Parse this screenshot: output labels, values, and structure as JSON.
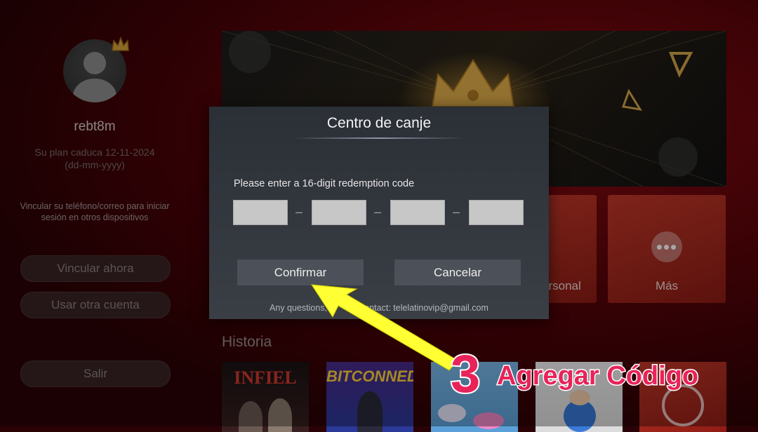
{
  "profile": {
    "username": "rebt8m",
    "plan_expiry": "Su plan caduca 12-11-2024",
    "date_format": "(dd-mm-yyyy)",
    "link_message_line1": "Vincular su teléfono/correo para iniciar",
    "link_message_line2": "sesión en otros dispositivos",
    "buttons": {
      "link_now": "Vincular ahora",
      "use_other_account": "Usar otra cuenta",
      "exit": "Salir"
    }
  },
  "tiles": [
    {
      "label": "ersonal"
    },
    {
      "label": "Más",
      "icon": "more-dots-icon"
    }
  ],
  "history": {
    "title": "Historia",
    "thumbnails": [
      {
        "title": "INFIEL"
      },
      {
        "title": "BITCONNED"
      },
      {
        "title": ""
      },
      {
        "title": ""
      },
      {
        "title": ""
      }
    ]
  },
  "dialog": {
    "title": "Centro de canje",
    "prompt": "Please enter a 16-digit redemption code",
    "code_fields": [
      "",
      "",
      "",
      ""
    ],
    "separator": "–",
    "confirm_label": "Confirmar",
    "cancel_label": "Cancelar",
    "contact_prefix": "Any questions,",
    "contact_suffix": "contact: telelatinovip@gmail.com"
  },
  "annotation": {
    "step": "3",
    "text": "Agregar Código",
    "color": "#e8235a",
    "arrow_color": "#ffff33"
  }
}
